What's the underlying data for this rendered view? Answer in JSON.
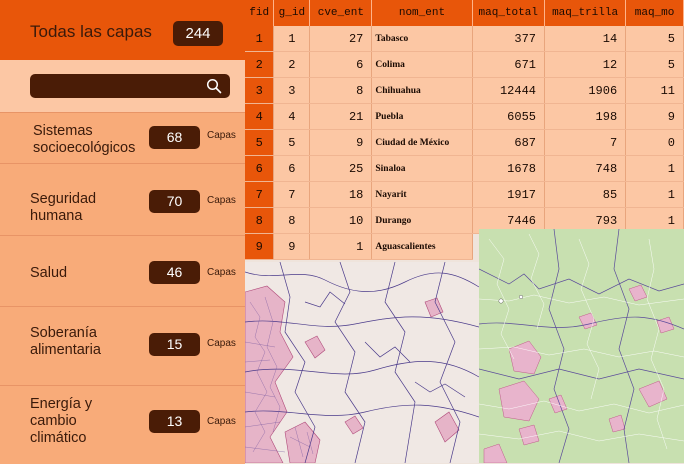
{
  "sidebar": {
    "all_layers": {
      "label": "Todas las capas",
      "count": "244"
    },
    "search": {
      "value": "",
      "placeholder": ""
    },
    "categories": [
      {
        "name_line1": "Sistemas",
        "name_line2": "socioecológicos",
        "count": "68",
        "unit": "Capas"
      },
      {
        "name_line1": "Seguridad",
        "name_line2": "humana",
        "count": "70",
        "unit": "Capas"
      },
      {
        "name_line1": "Salud",
        "name_line2": "",
        "count": "46",
        "unit": "Capas"
      },
      {
        "name_line1": "Soberanía",
        "name_line2": "alimentaria",
        "count": "15",
        "unit": "Capas"
      },
      {
        "name_line1": "Energía y",
        "name_line2": "cambio",
        "name_line3": "climático",
        "count": "13",
        "unit": "Capas"
      }
    ]
  },
  "table": {
    "columns": [
      "fid",
      "g_id",
      "cve_ent",
      "nom_ent",
      "maq_total",
      "maq_trilla",
      "maq_mo"
    ],
    "rows": [
      [
        "1",
        "1",
        "27",
        "Tabasco",
        "377",
        "14",
        "5"
      ],
      [
        "2",
        "2",
        "6",
        "Colima",
        "671",
        "12",
        "5"
      ],
      [
        "3",
        "3",
        "8",
        "Chihuahua",
        "12444",
        "1906",
        "11"
      ],
      [
        "4",
        "4",
        "21",
        "Puebla",
        "6055",
        "198",
        "9"
      ],
      [
        "5",
        "5",
        "9",
        "Ciudad de México",
        "687",
        "7",
        "0"
      ],
      [
        "6",
        "6",
        "25",
        "Sinaloa",
        "1678",
        "748",
        "1"
      ],
      [
        "7",
        "7",
        "18",
        "Nayarit",
        "1917",
        "85",
        "1"
      ],
      [
        "8",
        "8",
        "10",
        "Durango",
        "7446",
        "793",
        "1"
      ],
      [
        "9",
        "9",
        "1",
        "Aguascalientes",
        "",
        "",
        ""
      ]
    ]
  },
  "colors": {
    "accent": "#e8560a",
    "sidebar_bg": "#f8ab79",
    "badge_bg": "#4a1c06",
    "map_left_bg": "#f0e8e4",
    "map_right_bg": "#c8e0b0"
  },
  "icons": {
    "search": "search-icon"
  }
}
